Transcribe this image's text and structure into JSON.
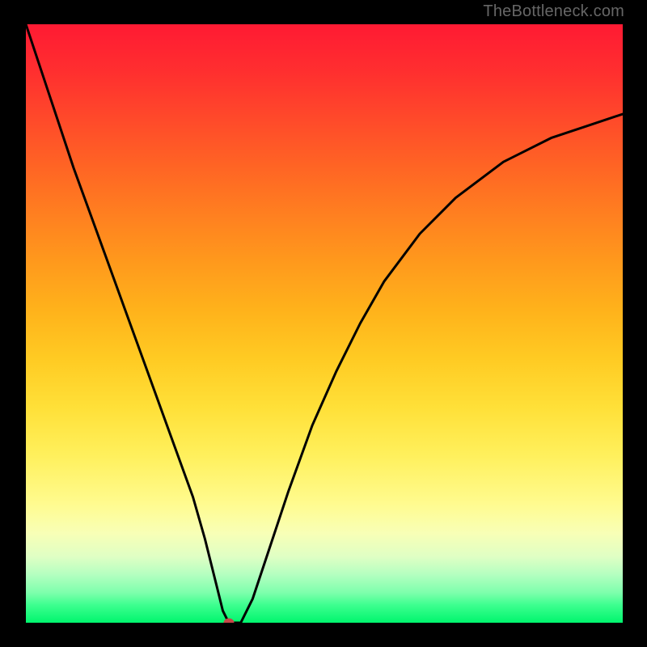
{
  "watermark": "TheBottleneck.com",
  "colors": {
    "frame": "#000000",
    "curve": "#000000",
    "marker": "#c64848"
  },
  "chart_data": {
    "type": "line",
    "title": "",
    "xlabel": "",
    "ylabel": "",
    "xlim": [
      0,
      100
    ],
    "ylim": [
      0,
      100
    ],
    "grid": false,
    "legend": false,
    "annotations": [
      {
        "text": "TheBottleneck.com",
        "position": "top-right"
      }
    ],
    "series": [
      {
        "name": "bottleneck-curve",
        "x": [
          0,
          4,
          8,
          12,
          16,
          20,
          24,
          28,
          30,
          32,
          33,
          34,
          36,
          38,
          40,
          44,
          48,
          52,
          56,
          60,
          66,
          72,
          80,
          88,
          94,
          100
        ],
        "values": [
          100,
          88,
          76,
          65,
          54,
          43,
          32,
          21,
          14,
          6,
          2,
          0,
          0,
          4,
          10,
          22,
          33,
          42,
          50,
          57,
          65,
          71,
          77,
          81,
          83,
          85
        ]
      }
    ],
    "marker": {
      "x": 34,
      "y": 0
    }
  }
}
